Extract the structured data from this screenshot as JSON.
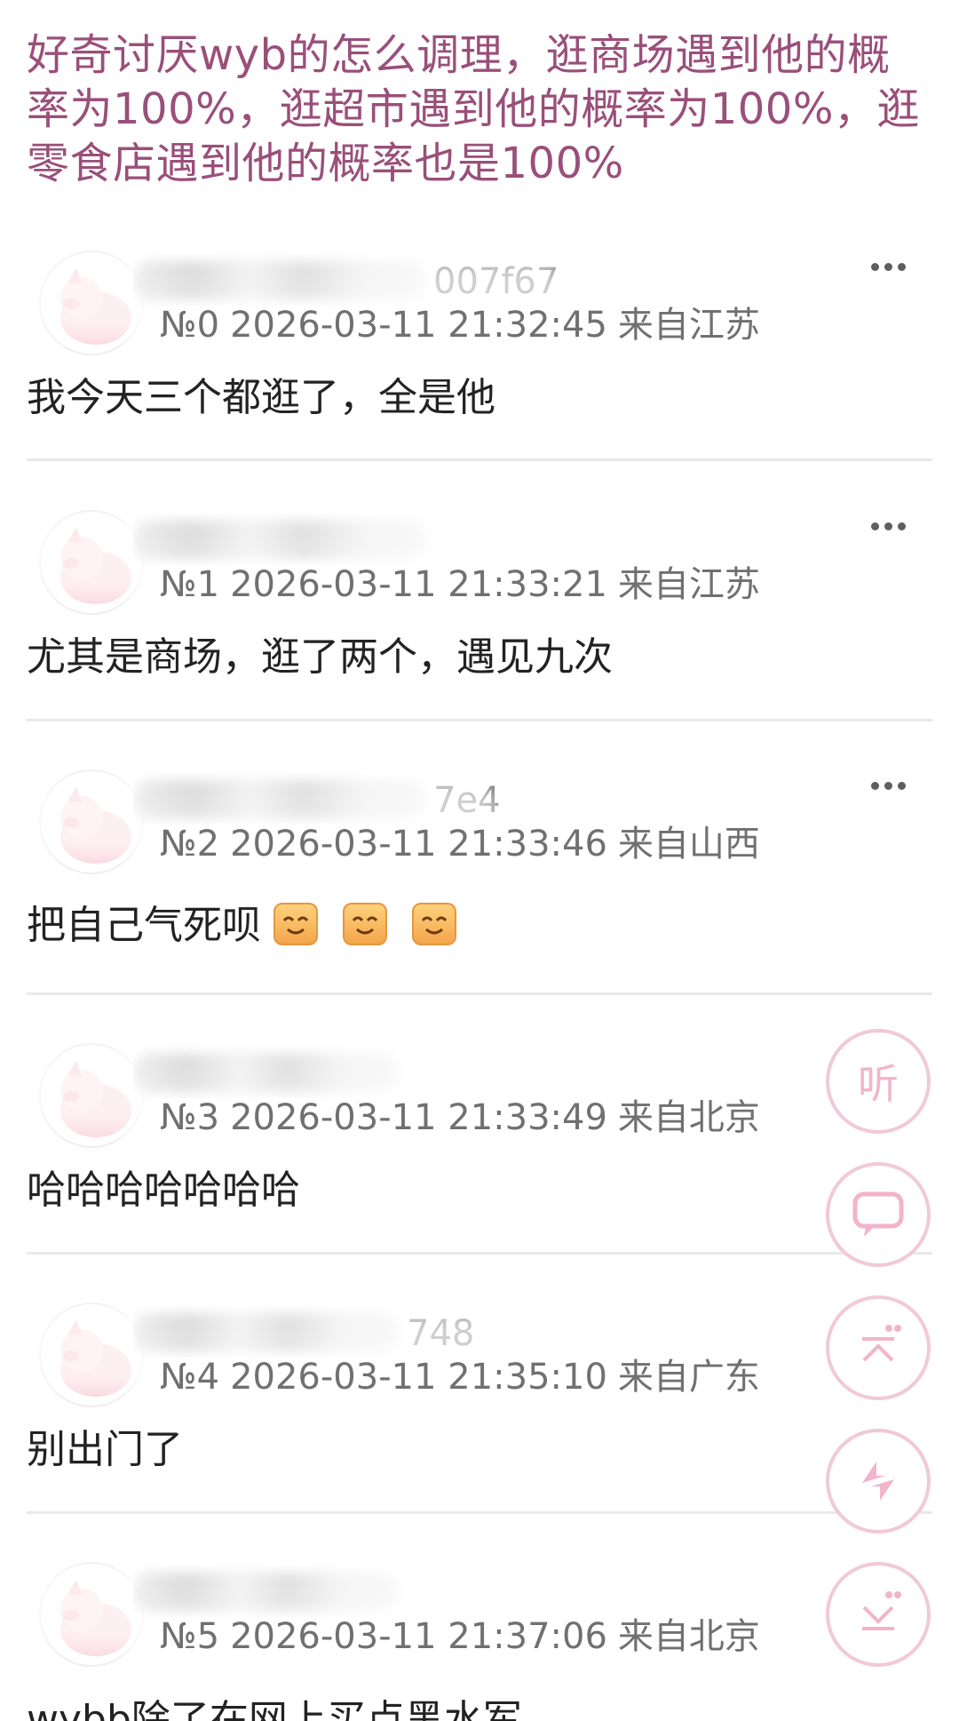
{
  "post": {
    "title": "好奇讨厌wyb的怎么调理，逛商场遇到他的概率为100%，逛超市遇到他的概率为100%，逛零食店遇到他的概率也是100%"
  },
  "replies": [
    {
      "username_tail": "007f67",
      "floor": "№0",
      "time": "2026-03-11 21:32:45",
      "location": "来自江苏",
      "content": "我今天三个都逛了，全是他"
    },
    {
      "username_tail": "",
      "floor": "№1",
      "time": "2026-03-11 21:33:21",
      "location": "来自江苏",
      "content": "尤其是商场，逛了两个，遇见九次"
    },
    {
      "username_tail": "7e4",
      "floor": "№2",
      "time": "2026-03-11 21:33:46",
      "location": "来自山西",
      "content": "把自己气死呗"
    },
    {
      "username_tail": "",
      "floor": "№3",
      "time": "2026-03-11 21:33:49",
      "location": "来自北京",
      "content": "哈哈哈哈哈哈哈"
    },
    {
      "username_tail": "748",
      "floor": "№4",
      "time": "2026-03-11 21:35:10",
      "location": "来自广东",
      "content": "别出门了"
    },
    {
      "username_tail": "",
      "floor": "№5",
      "time": "2026-03-11 21:37:06",
      "location": "来自北京",
      "content": "wybb除了在网上买点黑水军"
    }
  ],
  "fab": {
    "listen_label": "听"
  },
  "colors": {
    "title": "#9a4f7a",
    "fab_border": "#f1c9d9",
    "fab_icon": "#f2b4cb",
    "divider": "#e9e9e9"
  },
  "icons": [
    "more-icon",
    "avatar-pig-icon",
    "emoji-smile-icon",
    "comment-icon",
    "top-arrow-icon",
    "refresh-icon",
    "bottom-arrow-icon"
  ]
}
